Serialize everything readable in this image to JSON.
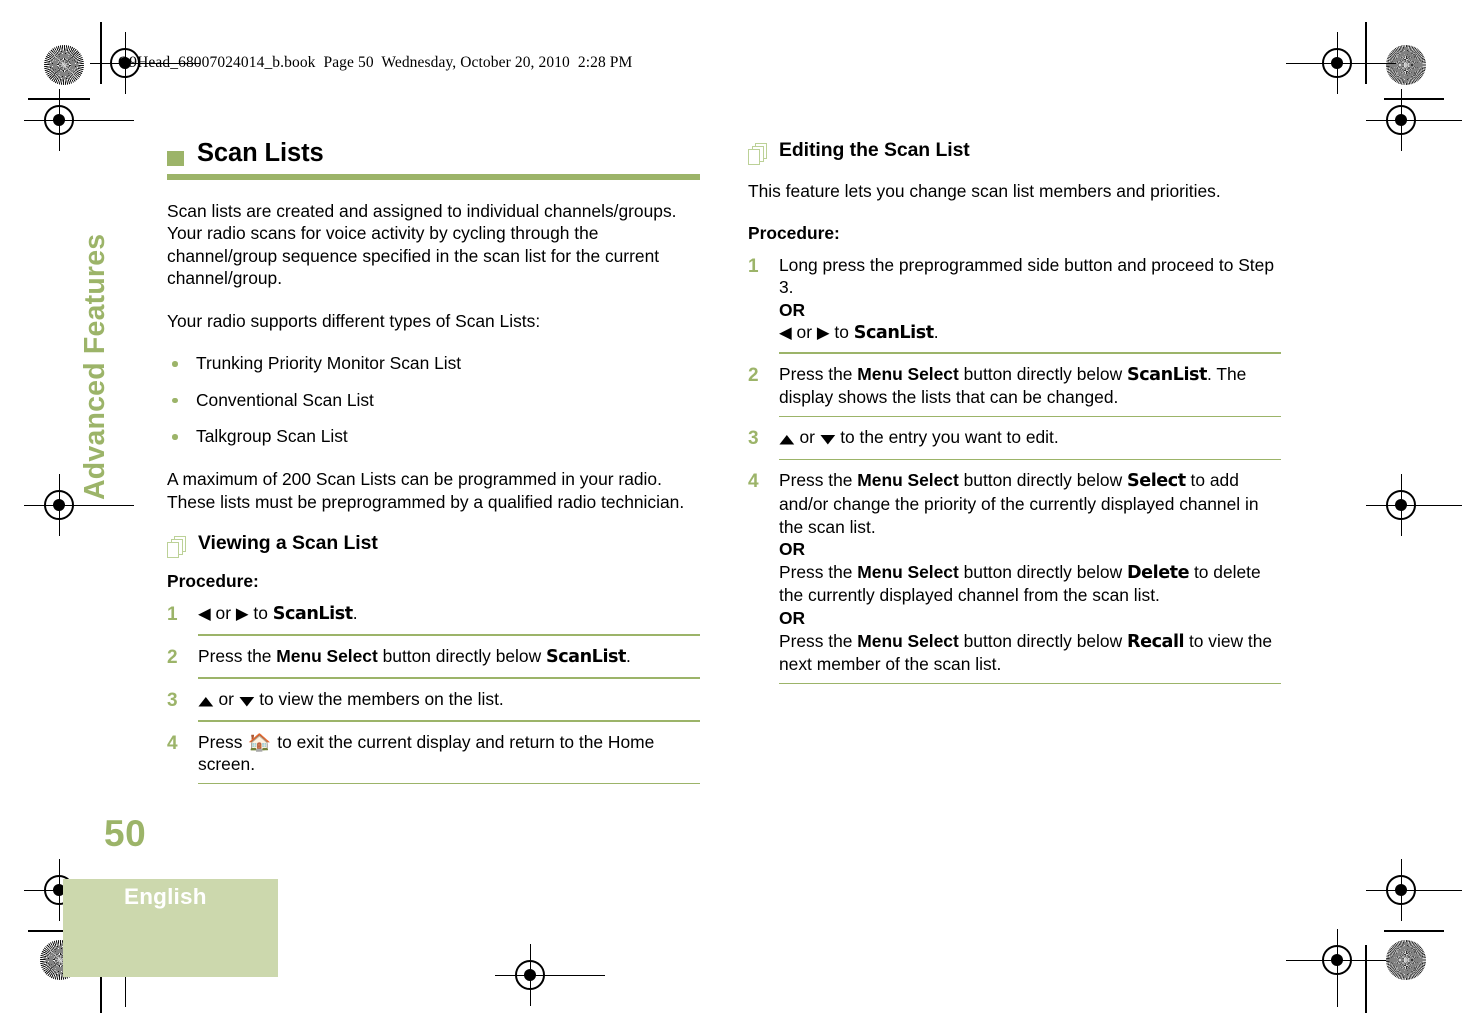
{
  "document": {
    "running_header": "O9Head_68007024014_b.book  Page 50  Wednesday, October 20, 2010  2:28 PM",
    "chapter_tab": "Advanced Features",
    "page_number": "50",
    "language": "English",
    "accent_color": "#9cb469",
    "band_color": "#ccd8ad",
    "icon_outline_color": "#bcd197"
  },
  "left_column": {
    "heading": "Scan Lists",
    "heading_marker": "square-marker",
    "paragraphs": [
      "Scan lists are created and assigned to individual channels/groups. Your radio scans for voice activity by cycling through the channel/group sequence specified in the scan list for the current channel/group.",
      "Your radio supports different types of Scan Lists:"
    ],
    "bullets": [
      "Trunking Priority Monitor Scan List",
      "Conventional Scan List",
      "Talkgroup Scan List"
    ],
    "paragraph_after_bullets": "A maximum of 200 Scan Lists can be programmed in your radio. These lists must be preprogrammed by a qualified radio technician.",
    "section": {
      "icon": "page-stack-icon",
      "title": "Viewing a Scan List",
      "procedure_label": "Procedure:",
      "steps": [
        {
          "number": "1",
          "parts": [
            {
              "type": "glyph",
              "name": "left-arrow-key",
              "glyph": "◀"
            },
            {
              "type": "text",
              "text": " or "
            },
            {
              "type": "glyph",
              "name": "right-arrow-key",
              "glyph": "▶"
            },
            {
              "type": "text",
              "text": " to "
            },
            {
              "type": "display",
              "text": "ScanList"
            },
            {
              "type": "text",
              "text": "."
            }
          ]
        },
        {
          "number": "2",
          "parts": [
            {
              "type": "text",
              "text": "Press the "
            },
            {
              "type": "bold",
              "text": "Menu Select"
            },
            {
              "type": "text",
              "text": " button directly below "
            },
            {
              "type": "display",
              "text": "ScanList"
            },
            {
              "type": "text",
              "text": "."
            }
          ]
        },
        {
          "number": "3",
          "parts": [
            {
              "type": "glyph",
              "name": "up-arrow-key",
              "glyph": "▲"
            },
            {
              "type": "text",
              "text": " or "
            },
            {
              "type": "glyph",
              "name": "down-arrow-key",
              "glyph": "▼"
            },
            {
              "type": "text",
              "text": " to view the members on the list."
            }
          ]
        },
        {
          "number": "4",
          "parts": [
            {
              "type": "text",
              "text": "Press "
            },
            {
              "type": "glyph",
              "name": "home-key",
              "glyph": "⌂"
            },
            {
              "type": "text",
              "text": " to exit the current display and return to the Home screen."
            }
          ]
        }
      ]
    }
  },
  "right_column": {
    "section": {
      "icon": "page-stack-icon",
      "title": "Editing the Scan List",
      "intro": "This feature lets you change scan list members and priorities.",
      "procedure_label": "Procedure:",
      "or_label": "OR",
      "steps": [
        {
          "number": "1",
          "lines": [
            [
              {
                "type": "text",
                "text": "Long press the preprogrammed side button and proceed to Step 3."
              }
            ],
            [
              {
                "type": "bold",
                "text": "OR"
              }
            ],
            [
              {
                "type": "glyph",
                "name": "left-arrow-key",
                "glyph": "◀"
              },
              {
                "type": "text",
                "text": " or "
              },
              {
                "type": "glyph",
                "name": "right-arrow-key",
                "glyph": "▶"
              },
              {
                "type": "text",
                "text": " to "
              },
              {
                "type": "display",
                "text": "ScanList"
              },
              {
                "type": "text",
                "text": "."
              }
            ]
          ]
        },
        {
          "number": "2",
          "lines": [
            [
              {
                "type": "text",
                "text": "Press the "
              },
              {
                "type": "bold",
                "text": "Menu Select"
              },
              {
                "type": "text",
                "text": " button directly below "
              },
              {
                "type": "display",
                "text": "ScanList"
              },
              {
                "type": "text",
                "text": ". The display shows the lists that can be changed."
              }
            ]
          ]
        },
        {
          "number": "3",
          "lines": [
            [
              {
                "type": "glyph",
                "name": "up-arrow-key",
                "glyph": "▲"
              },
              {
                "type": "text",
                "text": " or "
              },
              {
                "type": "glyph",
                "name": "down-arrow-key",
                "glyph": "▼"
              },
              {
                "type": "text",
                "text": " to the entry you want to edit."
              }
            ]
          ]
        },
        {
          "number": "4",
          "lines": [
            [
              {
                "type": "text",
                "text": "Press the "
              },
              {
                "type": "bold",
                "text": "Menu Select"
              },
              {
                "type": "text",
                "text": " button directly below "
              },
              {
                "type": "display",
                "text": "Select"
              },
              {
                "type": "text",
                "text": " to add and/or change the priority of the currently displayed channel in the scan list."
              }
            ],
            [
              {
                "type": "bold",
                "text": "OR"
              }
            ],
            [
              {
                "type": "text",
                "text": "Press the "
              },
              {
                "type": "bold",
                "text": "Menu Select"
              },
              {
                "type": "text",
                "text": " button directly below "
              },
              {
                "type": "display",
                "text": "Delete"
              },
              {
                "type": "text",
                "text": " to delete the currently displayed channel from the scan list."
              }
            ],
            [
              {
                "type": "bold",
                "text": "OR"
              }
            ],
            [
              {
                "type": "text",
                "text": "Press the "
              },
              {
                "type": "bold",
                "text": "Menu Select"
              },
              {
                "type": "text",
                "text": " button directly below "
              },
              {
                "type": "display",
                "text": "Recall"
              },
              {
                "type": "text",
                "text": " to view the next member of the scan list."
              }
            ]
          ]
        }
      ]
    }
  }
}
